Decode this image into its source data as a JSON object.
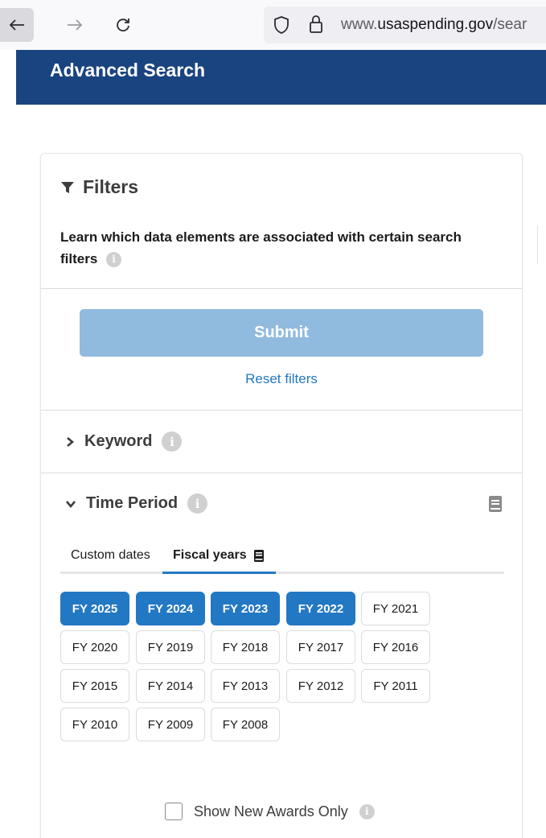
{
  "browser": {
    "url_prefix": "www.",
    "url_domain": "usaspending.gov",
    "url_suffix": "/sear"
  },
  "header": {
    "title": "Advanced Search"
  },
  "filters": {
    "title": "Filters",
    "description": "Learn which data elements are associated with certain search filters",
    "submit_label": "Submit",
    "reset_label": "Reset filters"
  },
  "keyword": {
    "label": "Keyword"
  },
  "time_period": {
    "label": "Time Period",
    "tabs": {
      "custom": "Custom dates",
      "fiscal": "Fiscal years"
    },
    "fiscal_years": [
      {
        "label": "FY 2025",
        "selected": true
      },
      {
        "label": "FY 2024",
        "selected": true
      },
      {
        "label": "FY 2023",
        "selected": true
      },
      {
        "label": "FY 2022",
        "selected": true
      },
      {
        "label": "FY 2021",
        "selected": false
      },
      {
        "label": "FY 2020",
        "selected": false
      },
      {
        "label": "FY 2019",
        "selected": false
      },
      {
        "label": "FY 2018",
        "selected": false
      },
      {
        "label": "FY 2017",
        "selected": false
      },
      {
        "label": "FY 2016",
        "selected": false
      },
      {
        "label": "FY 2015",
        "selected": false
      },
      {
        "label": "FY 2014",
        "selected": false
      },
      {
        "label": "FY 2013",
        "selected": false
      },
      {
        "label": "FY 2012",
        "selected": false
      },
      {
        "label": "FY 2011",
        "selected": false
      },
      {
        "label": "FY 2010",
        "selected": false
      },
      {
        "label": "FY 2009",
        "selected": false
      },
      {
        "label": "FY 2008",
        "selected": false
      }
    ],
    "new_awards_label": "Show New Awards Only"
  },
  "icons": {
    "back": "back-arrow-icon",
    "forward": "forward-arrow-icon",
    "reload": "reload-icon",
    "shield": "shield-icon",
    "lock": "lock-icon",
    "filter": "filter-icon",
    "info": "info-icon",
    "chevron_right": "chevron-right-icon",
    "chevron_down": "chevron-down-icon",
    "book": "book-icon"
  },
  "colors": {
    "header_bg": "#1a4480",
    "accent": "#2378c3",
    "submit_disabled": "#91badf"
  }
}
